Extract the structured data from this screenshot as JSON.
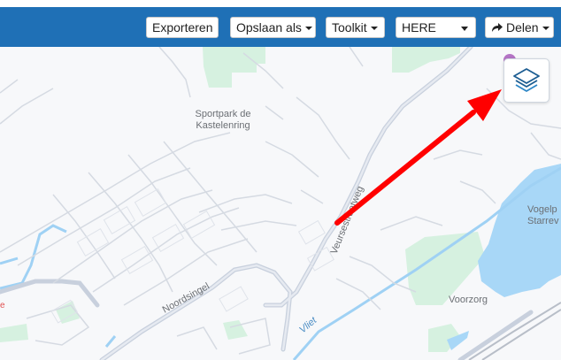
{
  "toolbar": {
    "export_label": "Exporteren",
    "save_as_label": "Opslaan als",
    "toolkit_label": "Toolkit",
    "basemap_selected": "HERE",
    "share_label": "Delen"
  },
  "map": {
    "labels": {
      "sportpark": "Sportpark de",
      "sportpark_line2": "Kastelenring",
      "street_veurse": "Veursestraatweg",
      "street_noordsingel": "Noordsingel",
      "water_vliet": "Vliet",
      "area_voorzorg": "Voorzorg",
      "area_vogelplas": "Vogelp",
      "area_vogelplas_line2": "Starrev"
    },
    "layers_button_icon": "layers-icon",
    "annotation_arrow_color": "#ff0000"
  },
  "colors": {
    "toolbar_bg": "#1f70b6",
    "water": "#a7d4f5",
    "park": "#cfeedb",
    "road": "#c7cfdc"
  }
}
